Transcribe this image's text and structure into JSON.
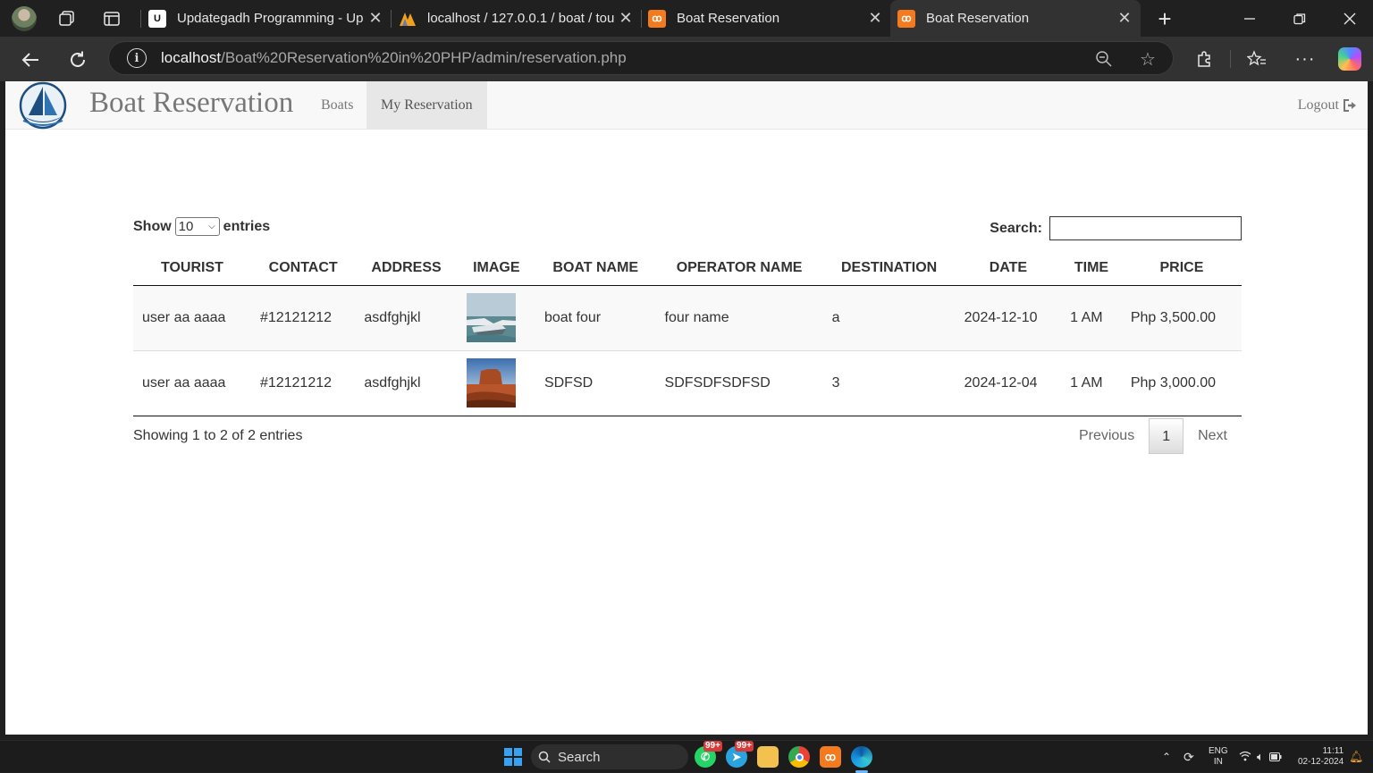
{
  "browser": {
    "tabs": [
      {
        "title": "Updategadh Programming - Up",
        "active": false
      },
      {
        "title": "localhost / 127.0.0.1 / boat / tou",
        "active": false
      },
      {
        "title": "Boat Reservation",
        "active": false
      },
      {
        "title": "Boat Reservation",
        "active": true
      }
    ],
    "url_host": "localhost",
    "url_path": "/Boat%20Reservation%20in%20PHP/admin/reservation.php"
  },
  "navbar": {
    "brand": "Boat Reservation",
    "links": [
      {
        "label": "Boats",
        "active": false
      },
      {
        "label": "My Reservation",
        "active": true
      }
    ],
    "logout_label": "Logout"
  },
  "datatable": {
    "show_label": "Show",
    "entries_label": "entries",
    "page_length": "10",
    "search_label": "Search:",
    "search_value": "",
    "columns": [
      "TOURIST",
      "CONTACT",
      "ADDRESS",
      "IMAGE",
      "BOAT NAME",
      "OPERATOR NAME",
      "DESTINATION",
      "DATE",
      "TIME",
      "PRICE"
    ],
    "rows": [
      {
        "tourist": "user aa aaaa",
        "contact": "#12121212",
        "address": "asdfghjkl",
        "image": "boat-photo",
        "boat_name": "boat four",
        "operator_name": "four name",
        "destination": "a",
        "date": "2024-12-10",
        "time": "1 AM",
        "price": "Php 3,500.00"
      },
      {
        "tourist": "user aa aaaa",
        "contact": "#12121212",
        "address": "asdfghjkl",
        "image": "desert-rock-photo",
        "boat_name": "SDFSD",
        "operator_name": "SDFSDFSDFSD",
        "destination": "3",
        "date": "2024-12-04",
        "time": "1 AM",
        "price": "Php 3,000.00"
      }
    ],
    "info": "Showing 1 to 2 of 2 entries",
    "pagination": {
      "previous": "Previous",
      "current": "1",
      "next": "Next"
    }
  },
  "taskbar": {
    "search_placeholder": "Search",
    "badge_whatsapp": "99+",
    "badge_telegram": "99+",
    "lang_line1": "ENG",
    "lang_line2": "IN",
    "time": "11:11",
    "date": "02-12-2024"
  },
  "colors": {
    "accent_xampp": "#f47a20",
    "brand_text": "#777777",
    "navbar_bg": "#f8f8f8",
    "row_odd": "#f9f9f9"
  }
}
